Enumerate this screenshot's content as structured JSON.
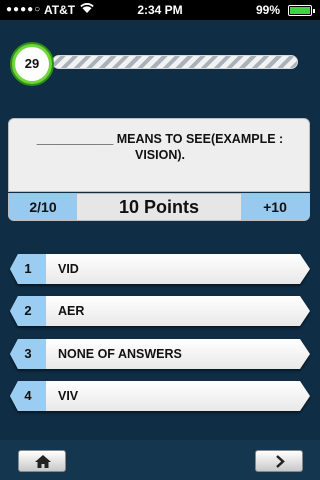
{
  "status_bar": {
    "signal": "●●●●○",
    "carrier": "AT&T",
    "time": "2:34 PM",
    "battery_percent": "99%",
    "battery_level": 0.99
  },
  "timer": {
    "seconds_left": "29",
    "progress_fraction": 0.0
  },
  "question": {
    "text": "___________ MEANS TO SEE(EXAMPLE : VISION)."
  },
  "score": {
    "question_counter": "2/10",
    "points": "10 Points",
    "bonus": "+10"
  },
  "answers": [
    {
      "number": "1",
      "label": "VID"
    },
    {
      "number": "2",
      "label": "AER"
    },
    {
      "number": "3",
      "label": "NONE OF ANSWERS"
    },
    {
      "number": "4",
      "label": "VIV"
    }
  ],
  "icons": {
    "home": "home-icon",
    "next": "chevron-right-icon",
    "wifi": "wifi-icon"
  },
  "colors": {
    "background": "#0f2d44",
    "accent_blue": "#98c9ef",
    "timer_green": "#6fd63c"
  }
}
